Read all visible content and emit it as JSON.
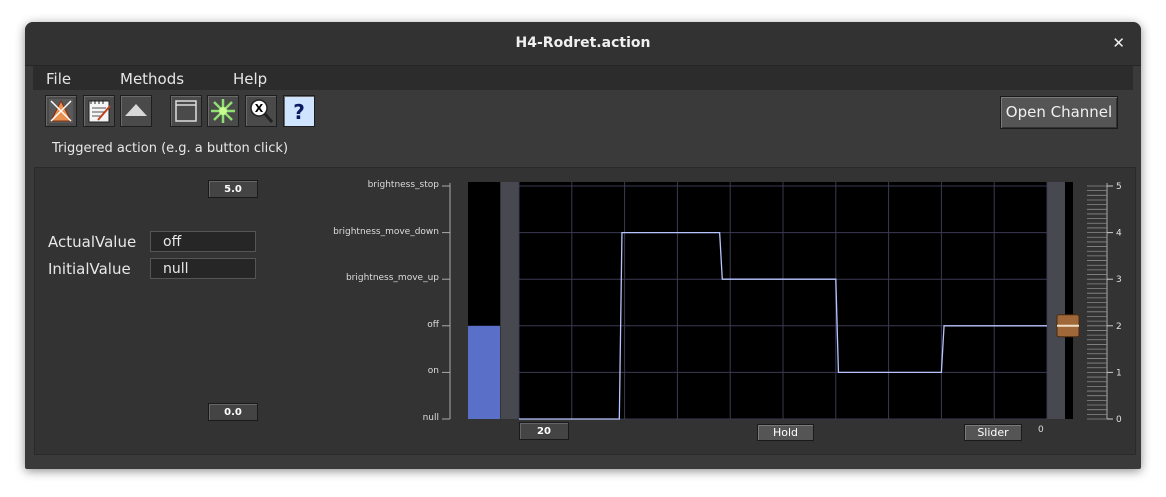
{
  "window": {
    "title": "H4-Rodret.action"
  },
  "menu": [
    "File",
    "Methods",
    "Help"
  ],
  "toolbar": {
    "icons": [
      "graph-icon",
      "notepad-icon",
      "up-arrow-icon",
      "window-icon",
      "star-burst-icon",
      "magnifier-icon",
      "help-icon"
    ],
    "open_channel_label": "Open Channel",
    "description": "Triggered action (e.g. a button click)"
  },
  "left": {
    "max_value": "5.0",
    "min_value": "0.0",
    "actual_label": "ActualValue",
    "actual_value": "off",
    "initial_label": "InitialValue",
    "initial_value": "null"
  },
  "plot": {
    "time_span": "20",
    "hold_label": "Hold",
    "slider_label": "Slider",
    "slider_value": "0",
    "bar_color": "#5a70c8",
    "trace_color": "#b8c4ff"
  },
  "chart_data": {
    "type": "line",
    "y_categories": [
      "null",
      "on",
      "off",
      "brightness_move_up",
      "brightness_move_down",
      "brightness_stop"
    ],
    "ylim": [
      0,
      5
    ],
    "y_ticks": [
      "0",
      "1",
      "2",
      "3",
      "4",
      "5"
    ],
    "xlim": [
      0,
      20
    ],
    "grid": true,
    "current_bar_value": 2,
    "series": [
      {
        "x": [
          0,
          3.8,
          3.9,
          7.6,
          7.7,
          12.0,
          12.1,
          16.0,
          16.1,
          20
        ],
        "y": [
          0,
          0,
          4,
          4,
          3,
          3,
          1,
          1,
          2,
          2
        ]
      }
    ]
  }
}
